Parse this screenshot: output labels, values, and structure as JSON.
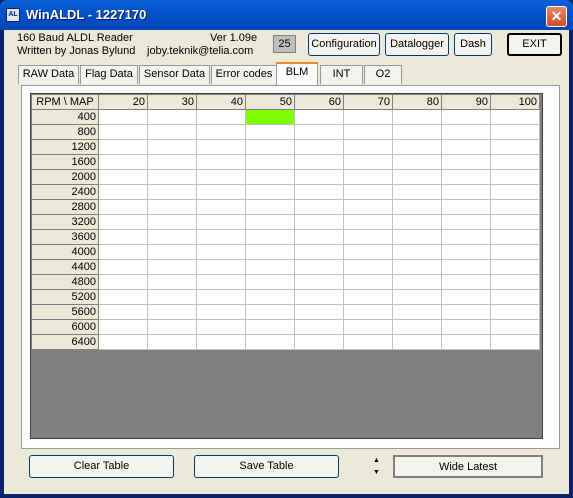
{
  "window": {
    "title": "WinALDL - 1227170",
    "icon": "aldl-app-icon"
  },
  "header": {
    "line1": "160 Baud ALDL Reader",
    "line2": "Written by Jonas Bylund",
    "version": "Ver 1.09e",
    "email": "joby.teknik@telia.com",
    "counter": "25"
  },
  "toolbar": {
    "configuration": "Configuration",
    "datalogger": "Datalogger",
    "dash": "Dash",
    "exit": "EXIT"
  },
  "tabs": [
    "RAW Data",
    "Flag Data",
    "Sensor Data",
    "Error codes",
    "BLM",
    "INT",
    "O2"
  ],
  "active_tab": "BLM",
  "grid": {
    "corner": "RPM \\ MAP",
    "map_headers": [
      "20",
      "30",
      "40",
      "50",
      "60",
      "70",
      "80",
      "90",
      "100"
    ],
    "rpm_rows": [
      "400",
      "800",
      "1200",
      "1600",
      "2000",
      "2400",
      "2800",
      "3200",
      "3600",
      "4000",
      "4400",
      "4800",
      "5200",
      "5600",
      "6000",
      "6400"
    ],
    "highlight": {
      "rpm": "400",
      "map": "50",
      "color": "#80ff00"
    }
  },
  "footer": {
    "clear_table": "Clear Table",
    "save_table": "Save Table",
    "wide_latest": "Wide Latest"
  },
  "colors": {
    "accent_tab": "#e68b2c",
    "highlight": "#80ff00",
    "titlebar": "#0352c9"
  }
}
